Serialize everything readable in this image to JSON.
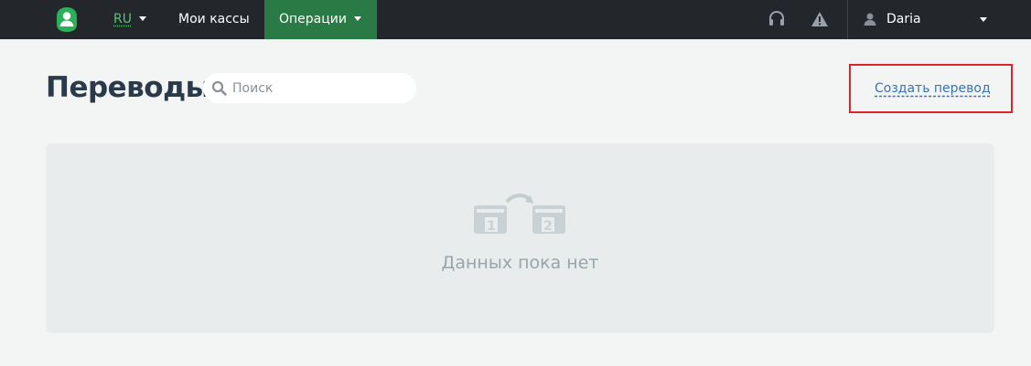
{
  "topbar": {
    "lang": "RU",
    "nav_cashboxes": "Мои кассы",
    "nav_operations": "Операции",
    "user_name": "Daria"
  },
  "page": {
    "title": "Переводы",
    "search_placeholder": "Поиск",
    "create_link": "Создать перевод",
    "empty_text": "Данных пока нет"
  },
  "colors": {
    "topbar_bg": "#23272b",
    "active_nav_bg": "#2a7a45",
    "brand_green": "#5fc07a",
    "highlight_border": "#e0242b",
    "link": "#3a73b3"
  },
  "icons": [
    "logo-icon",
    "headset-icon",
    "warning-icon",
    "user-icon",
    "search-icon",
    "transfer-icon"
  ]
}
